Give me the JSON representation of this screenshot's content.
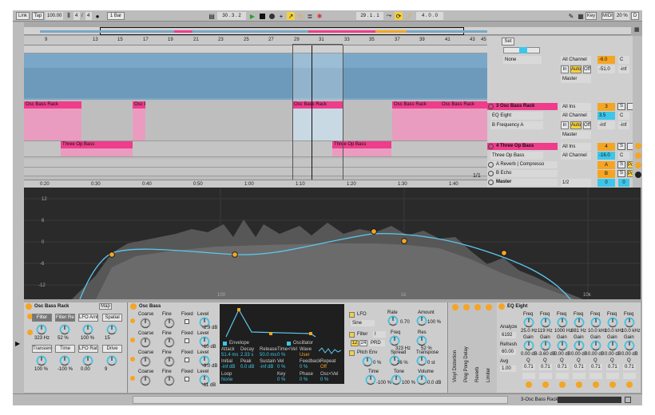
{
  "transport": {
    "link": "Link",
    "tap": "Tap",
    "tempo": "100.00",
    "sig_num": "4",
    "sig_sep": "/",
    "sig_den": "4",
    "metro": "1 Bar",
    "position": "30 . 3 . 2",
    "loop_start": "29 . 1 . 1",
    "loop_length": "4 . 0 . 0",
    "key": "Key",
    "midi": "MIDI",
    "cpu": "20 %",
    "disk": "D"
  },
  "ruler": {
    "bars": [
      "9",
      "13",
      "15",
      "17",
      "19",
      "21",
      "23",
      "25",
      "27",
      "29",
      "31",
      "33",
      "35",
      "37",
      "39",
      "41",
      "43",
      "45"
    ],
    "times": [
      "0:20",
      "0:30",
      "0:40",
      "0:50",
      "1:00",
      "1:10",
      "1:20",
      "1:30",
      "1:40"
    ],
    "zoom": "1/1"
  },
  "clips": {
    "osc_bass_rack": "Osc Bass Rack",
    "three_op_bass": "Three Op Bass"
  },
  "mixer": {
    "top_input": "None",
    "all_channels": "All Channel",
    "in": "In",
    "auto": "Auto",
    "off": "Off",
    "master": "Master",
    "vol_top": "-6.0",
    "pan_top": "C",
    "send_a": "-51.0",
    "send_b": "-inf",
    "track3": {
      "num": "3",
      "name": "3 Osc Bass Rack",
      "input": "All Ins",
      "device": "EQ Eight",
      "param": "B Frequency A",
      "vol": "3.5",
      "pan": "C",
      "send_a": "-inf",
      "send_b": "-inf",
      "master": "Master",
      "s": "S"
    },
    "track4": {
      "num": "4",
      "name": "4 Three Op Bass",
      "input": "All Ins",
      "device": "Three Op Bass",
      "vol": "-16.0",
      "pan": "C",
      "s": "S"
    },
    "return_a": {
      "name": "A Reverb | Compresso",
      "letter": "A",
      "s": "S",
      "post": "Post"
    },
    "return_b": {
      "name": "B Echo",
      "letter": "B",
      "s": "S",
      "post": "Post"
    },
    "master_track": {
      "name": "Master",
      "select": "1/2",
      "vol": "0",
      "pan": "0"
    },
    "set_label": "Set"
  },
  "eq_display": {
    "db_labels": [
      "12",
      "6",
      "0",
      "-6",
      "-12"
    ],
    "freq_labels": [
      "100",
      "1k",
      "10k"
    ]
  },
  "devices": {
    "rack": {
      "title": "Osc Bass Rack",
      "map": "Map",
      "macros": [
        {
          "label": "Filter",
          "value": "323 Hz"
        },
        {
          "label": "Filter Res",
          "value": "52 %"
        },
        {
          "label": "LFO Amt",
          "value": "100 %"
        },
        {
          "label": "Spatial",
          "value": "15"
        },
        {
          "label": "Transient",
          "value": "100 %"
        },
        {
          "label": "Time",
          "value": "-100 %"
        },
        {
          "label": "LFO Rate",
          "value": "0.00"
        },
        {
          "label": "Drive",
          "value": "9"
        }
      ]
    },
    "osc_bass": {
      "title": "Osc Bass",
      "rows": [
        {
          "coarse": "Coarse",
          "fine": "Fine",
          "fixed": "Fixed",
          "level": "Level",
          "level_val": "-2.9 dB"
        },
        {
          "coarse": "Coarse",
          "fine": "Fine",
          "fixed": "Fixed",
          "level": "Level",
          "level_val": "-10 dB"
        },
        {
          "coarse": "Coarse",
          "fine": "Fine",
          "fixed": "Fixed",
          "level": "Level",
          "level_val": "-9.0 dB"
        },
        {
          "coarse": "Coarse",
          "fine": "Fine",
          "fixed": "Fixed",
          "level": "Level",
          "level_val": "-11 dB"
        }
      ],
      "env_labels": {
        "attack": "Attack",
        "decay": "Decay",
        "release": "Release",
        "timevel": "Time<Vel",
        "wave": "Wave"
      },
      "env_values": {
        "attack": "51.4 ms",
        "decay": "2.33 s",
        "release": "50.0 ms",
        "timevel": "0 %",
        "wave": "User"
      },
      "env_labels2": {
        "initial": "Initial",
        "peak": "Peak",
        "sustain": "Sustain",
        "vel": "Vel",
        "feedback": "Feedback",
        "repeat": "Repeat"
      },
      "env_values2": {
        "initial": "-inf dB",
        "peak": "0.0 dB",
        "sustain": "-inf dB",
        "vel": "0 %",
        "feedback": "0 %",
        "repeat": "Off"
      },
      "env_labels3": {
        "loop": "Loop",
        "key": "Key",
        "phase": "Phase",
        "osc_vel": "Osc<Vel"
      },
      "env_values3": {
        "loop": "None",
        "key": "0 %",
        "phase": "0 %",
        "osc_vel": "0 %"
      },
      "tab_envelope": "Envelope",
      "tab_oscillator": "Oscillator"
    },
    "lfo": {
      "lfo": "LFO",
      "wave": "Sine",
      "rate_label": "Rate",
      "rate_val": "0.70",
      "amount_label": "Amount",
      "amount_val": "100 %",
      "filter": "Filter",
      "filter_sel": "I",
      "freq_label": "Freq",
      "freq_val": "323 Hz",
      "res_label": "Res",
      "res_val": "52 %",
      "slope_12": "12",
      "slope_24": "24",
      "prd": "PRD",
      "pitch_env": "Pitch Env",
      "pitch_val": "0 %",
      "spread_label": "Spread",
      "spread_val": "26 %",
      "transpose_label": "Transpose",
      "transpose_val": "0 st",
      "time_label": "Time",
      "time_val": "-100 %",
      "tone_label": "Tone",
      "tone_val": "100 %",
      "volume_label": "Volume",
      "volume_val": "-0.0 dB"
    },
    "chain": [
      "Vinyl Distortion",
      "Ping Pong Delay",
      "Reverb",
      "Limiter"
    ],
    "eq_eight": {
      "title": "EQ Eight",
      "analyze": "Analyze",
      "adapt_q": "6192",
      "refresh": "Refresh",
      "refresh_val": "60.00",
      "avg": "Avg",
      "avg_val": "1.00",
      "bands": [
        {
          "freq": "25.0 Hz",
          "gain": "0.00 dB",
          "q": "0.71"
        },
        {
          "freq": "119 Hz",
          "gain": "-3.60 dB",
          "q": "0.71"
        },
        {
          "freq": "1000 Hz",
          "gain": "0.00 dB",
          "q": "0.71"
        },
        {
          "freq": "881 Hz",
          "gain": "0.00 dB",
          "q": "0.71"
        },
        {
          "freq": "10.0 kHz",
          "gain": "0.00 dB",
          "q": "0.71"
        },
        {
          "freq": "10.0 kHz",
          "gain": "0.00 dB",
          "q": "0.71"
        },
        {
          "freq": "10.0 kHz",
          "gain": "0.00 dB",
          "q": "0.71"
        }
      ],
      "freq_label": "Freq",
      "gain_label": "Gain",
      "q_label": "Q"
    }
  },
  "statusbar": {
    "track_label": "3-Osc Bass Rack"
  },
  "colors": {
    "accent": "#f4a523",
    "clip_blue": "#7aa7c7",
    "clip_pink": "#ee3d8b",
    "curve": "#5cc8ef",
    "meter": "#3fcf3f"
  }
}
